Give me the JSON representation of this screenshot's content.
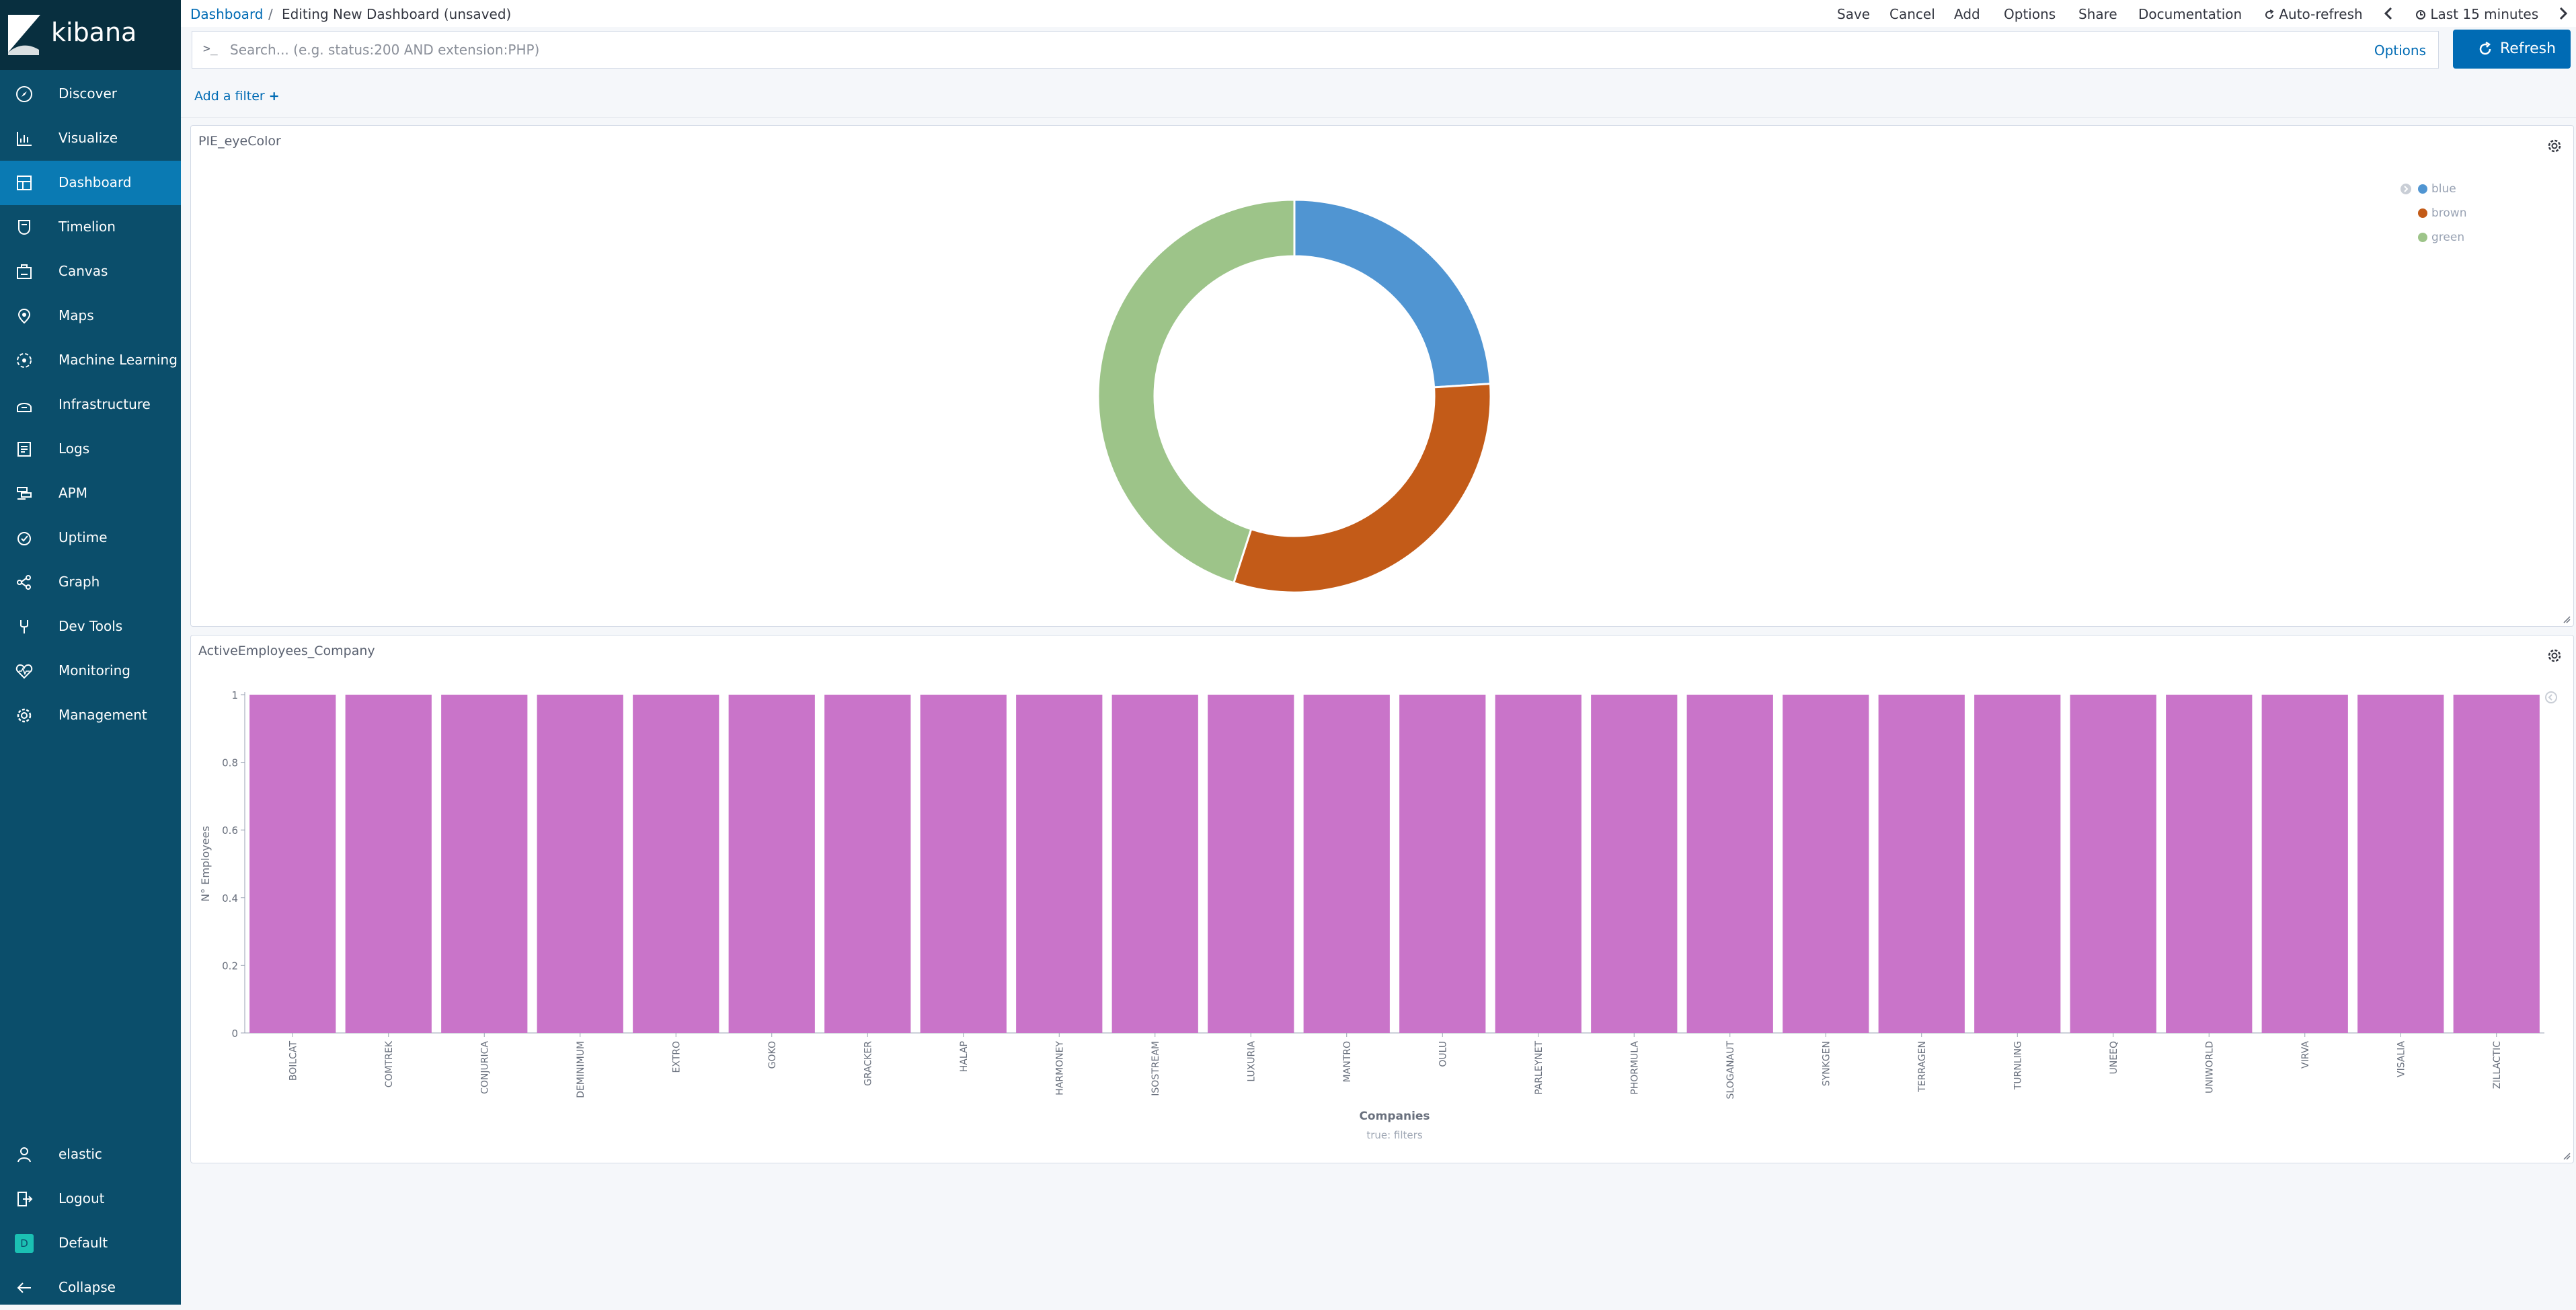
{
  "app": {
    "name": "kibana"
  },
  "breadcrumb": {
    "root": "Dashboard",
    "separator": "/",
    "current": "Editing New Dashboard (unsaved)"
  },
  "top_menu": {
    "save": "Save",
    "cancel": "Cancel",
    "add": "Add",
    "options": "Options",
    "share": "Share",
    "documentation": "Documentation",
    "auto_refresh": "Auto-refresh",
    "time_range": "Last 15 minutes"
  },
  "query": {
    "prompt": ">_",
    "placeholder": "Search... (e.g. status:200 AND extension:PHP)",
    "options": "Options"
  },
  "refresh": {
    "label": "Refresh"
  },
  "filters": {
    "add_label": "Add a filter"
  },
  "sidebar": {
    "items": [
      {
        "label": "Discover",
        "icon": "compass-icon",
        "active": false
      },
      {
        "label": "Visualize",
        "icon": "visualize-icon",
        "active": false
      },
      {
        "label": "Dashboard",
        "icon": "dashboard-icon",
        "active": true
      },
      {
        "label": "Timelion",
        "icon": "timelion-icon",
        "active": false
      },
      {
        "label": "Canvas",
        "icon": "canvas-icon",
        "active": false
      },
      {
        "label": "Maps",
        "icon": "maps-icon",
        "active": false
      },
      {
        "label": "Machine Learning",
        "icon": "machine-learning-icon",
        "active": false
      },
      {
        "label": "Infrastructure",
        "icon": "infrastructure-icon",
        "active": false
      },
      {
        "label": "Logs",
        "icon": "logs-icon",
        "active": false
      },
      {
        "label": "APM",
        "icon": "apm-icon",
        "active": false
      },
      {
        "label": "Uptime",
        "icon": "uptime-icon",
        "active": false
      },
      {
        "label": "Graph",
        "icon": "graph-icon",
        "active": false
      },
      {
        "label": "Dev Tools",
        "icon": "dev-tools-icon",
        "active": false
      },
      {
        "label": "Monitoring",
        "icon": "monitoring-icon",
        "active": false
      },
      {
        "label": "Management",
        "icon": "gear-icon",
        "active": false
      }
    ],
    "user": "elastic",
    "logout": "Logout",
    "space": "Default",
    "space_initial": "D",
    "collapse": "Collapse"
  },
  "colors": {
    "sidebar": "#0b4e6b",
    "active": "#0a7ab3",
    "primary": "#006bb4",
    "bar": "#c974c9"
  },
  "chart_data": [
    {
      "type": "pie",
      "title": "PIE_eyeColor",
      "donut": true,
      "legend_position": "top-right",
      "categories": [
        "blue",
        "brown",
        "green"
      ],
      "values": [
        24,
        31,
        45
      ],
      "colors": [
        "#5095d2",
        "#c35b18",
        "#9dc489"
      ]
    },
    {
      "type": "bar",
      "title": "ActiveEmployees_Company",
      "xlabel": "Companies",
      "ylabel": "N° Employees",
      "footnote": "true: filters",
      "ylim": [
        0,
        1
      ],
      "yticks": [
        "0",
        "0.2",
        "0.4",
        "0.6",
        "0.8",
        "1"
      ],
      "categories": [
        "BOILCAT",
        "COMTREK",
        "CONJURICA",
        "DEMINIMUM",
        "EXTRO",
        "GOKO",
        "GRACKER",
        "HALAP",
        "HARMONEY",
        "ISOSTREAM",
        "LUXURIA",
        "MANTRO",
        "OULU",
        "PARLEYNET",
        "PHORMULA",
        "SLOGANAUT",
        "SYNKGEN",
        "TERRAGEN",
        "TURNLING",
        "UNEEQ",
        "UNIWORLD",
        "VIRVA",
        "VISALIA",
        "ZILLACTIC"
      ],
      "values": [
        1,
        1,
        1,
        1,
        1,
        1,
        1,
        1,
        1,
        1,
        1,
        1,
        1,
        1,
        1,
        1,
        1,
        1,
        1,
        1,
        1,
        1,
        1,
        1
      ],
      "color": "#c974c9"
    }
  ]
}
